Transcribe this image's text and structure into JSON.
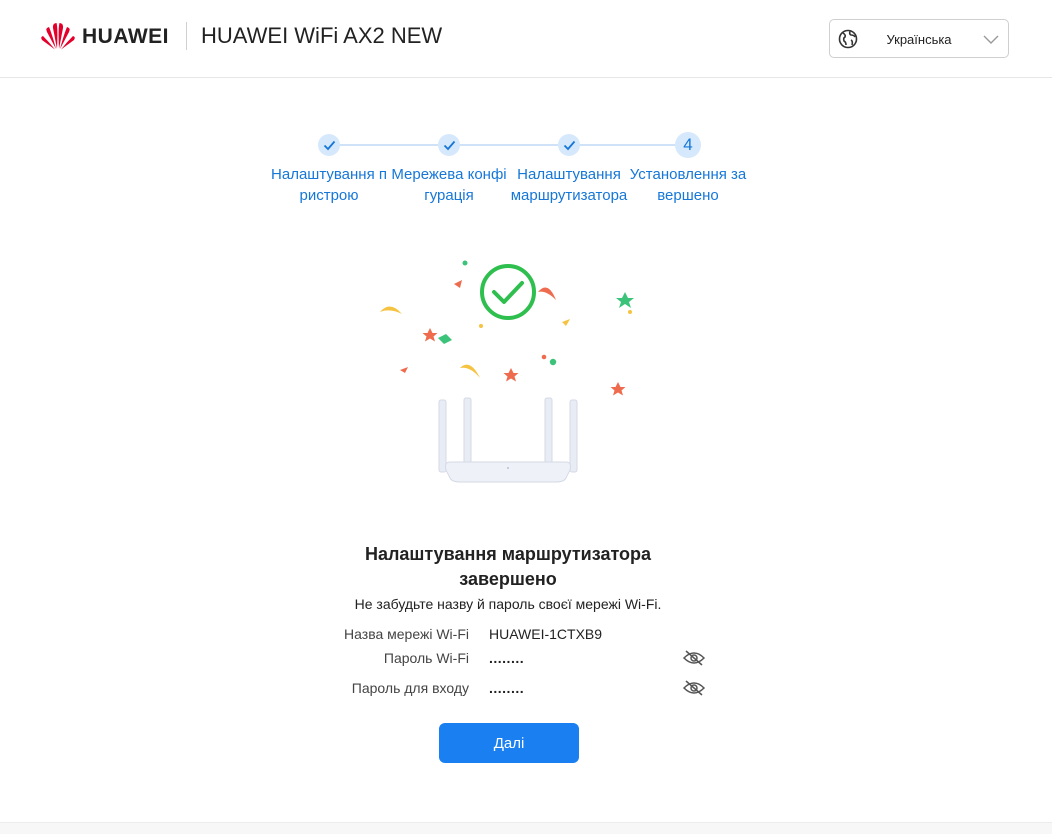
{
  "header": {
    "brand": "HUAWEI",
    "product": "HUAWEI WiFi AX2 NEW",
    "language": {
      "icon": "globe-icon",
      "selected": "Українська"
    }
  },
  "stepper": {
    "steps": [
      {
        "label": "Налаштування пристрою",
        "state": "done"
      },
      {
        "label": "Мережева конфігурація",
        "state": "done"
      },
      {
        "label": "Налаштування маршрутизатора",
        "state": "done"
      },
      {
        "label": "Установлення завершено",
        "state": "current",
        "number": "4"
      }
    ]
  },
  "result": {
    "title_line1": "Налаштування маршрутизатора",
    "title_line2": "завершено",
    "subtitle": "Не забудьте назву й пароль своєї мережі Wi-Fi."
  },
  "info": [
    {
      "label": "Назва мережі Wi-Fi",
      "value": "HUAWEI-1CTXB9"
    },
    {
      "label": "Пароль Wi-Fi",
      "value": "........",
      "icon": "eye-hidden-icon"
    },
    {
      "label": "Пароль для входу",
      "value": "........",
      "icon": "eye-hidden-icon"
    }
  ],
  "actions": {
    "next_label": "Далі"
  },
  "colors": {
    "accent": "#1a7ff0",
    "step_text": "#1677d8",
    "success": "#2fbf4e",
    "logo": "#e4002b"
  }
}
